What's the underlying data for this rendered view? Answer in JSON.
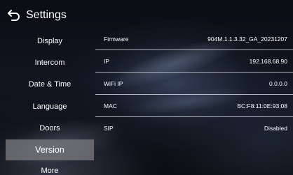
{
  "header": {
    "title": "Settings",
    "back_icon": "back-arrow-icon"
  },
  "sidebar": {
    "items": [
      {
        "label": "Display",
        "active": false
      },
      {
        "label": "Intercom",
        "active": false
      },
      {
        "label": "Date & Time",
        "active": false
      },
      {
        "label": "Language",
        "active": false
      },
      {
        "label": "Doors",
        "active": false
      },
      {
        "label": "Version",
        "active": true
      },
      {
        "label": "More",
        "active": false
      }
    ],
    "active_color": "#78787d"
  },
  "info": {
    "rows": [
      {
        "label": "Firmware",
        "value": "904M.1.1.3.32_GA_20231207"
      },
      {
        "label": "IP",
        "value": "192.168.68.90"
      },
      {
        "label": "WiFi IP",
        "value": "0.0.0.0"
      },
      {
        "label": "MAC",
        "value": "BC:F8:11:0E:93:08"
      },
      {
        "label": "SIP",
        "value": "Disabled"
      }
    ]
  }
}
